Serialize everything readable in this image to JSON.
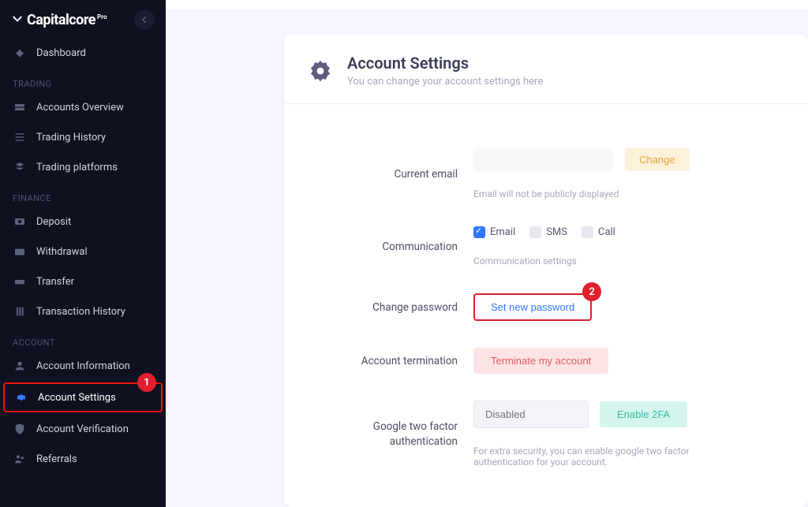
{
  "brand": {
    "name": "Capitalcore",
    "badge": "Pro"
  },
  "sidebar": {
    "dashboard": "Dashboard",
    "sections": {
      "trading": {
        "label": "TRADING",
        "items": [
          "Accounts Overview",
          "Trading History",
          "Trading platforms"
        ]
      },
      "finance": {
        "label": "FINANCE",
        "items": [
          "Deposit",
          "Withdrawal",
          "Transfer",
          "Transaction History"
        ]
      },
      "account": {
        "label": "ACCOUNT",
        "items": [
          "Account Information",
          "Account Settings",
          "Account Verification",
          "Referrals"
        ]
      }
    }
  },
  "page": {
    "title": "Account Settings",
    "subtitle": "You can change your account settings here"
  },
  "settings": {
    "email": {
      "label": "Current email",
      "change_label": "Change",
      "hint": "Email will not be publicly displayed"
    },
    "communication": {
      "label": "Communication",
      "email": "Email",
      "sms": "SMS",
      "call": "Call",
      "hint": "Communication settings"
    },
    "password": {
      "label": "Change password",
      "button": "Set new password"
    },
    "terminate": {
      "label": "Account termination",
      "button": "Terminate my account"
    },
    "twofa": {
      "label": "Google two factor authentication",
      "placeholder": "Disabled",
      "button": "Enable 2FA",
      "hint": "For extra security, you can enable google two factor authentication for your account."
    }
  },
  "callouts": {
    "one": "1",
    "two": "2"
  }
}
